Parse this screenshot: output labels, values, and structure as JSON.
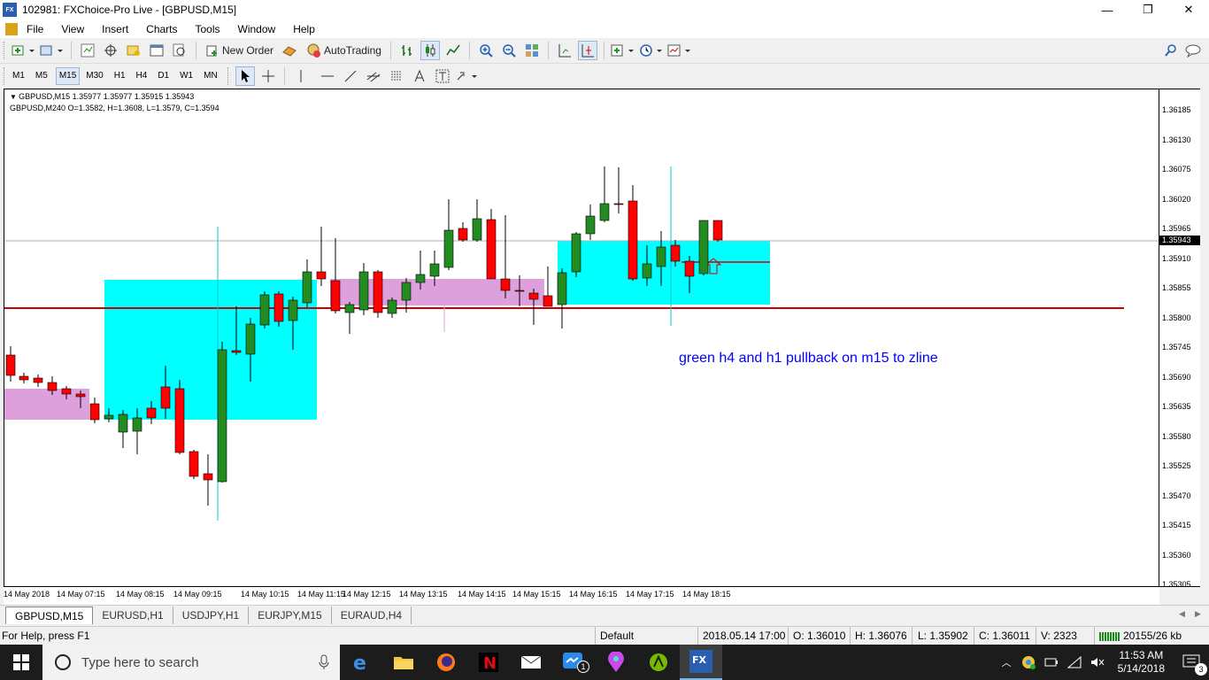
{
  "window": {
    "title": "102981: FXChoice-Pro Live - [GBPUSD,M15]",
    "logo_text": "FX",
    "minimize": "—",
    "maximize": "❐",
    "close": "✕"
  },
  "menu": [
    "File",
    "View",
    "Insert",
    "Charts",
    "Tools",
    "Window",
    "Help"
  ],
  "toolbar": {
    "new_order": "New Order",
    "autotrading": "AutoTrading"
  },
  "timeframes": [
    "M1",
    "M5",
    "M15",
    "M30",
    "H1",
    "H4",
    "D1",
    "W1",
    "MN"
  ],
  "active_timeframe": "M15",
  "chart": {
    "info_line_1": "GBPUSD,M15  1.35977 1.35977 1.35915 1.35943",
    "info_line_2": "GBPUSD,M240   O=1.3582,  H=1.3608,  L=1.3579,  C=1.3594",
    "annotation": "green h4 and h1 pullback on m15 to zline",
    "current_price_label": "1.35943",
    "price_ticks": [
      "1.36185",
      "1.36130",
      "1.36075",
      "1.36020",
      "1.35965",
      "1.35910",
      "1.35855",
      "1.35800",
      "1.35745",
      "1.35690",
      "1.35635",
      "1.35580",
      "1.35525",
      "1.35470",
      "1.35415",
      "1.35360",
      "1.35305"
    ],
    "time_ticks": [
      "14 May 2018",
      "14 May 07:15",
      "14 May 08:15",
      "14 May 09:15",
      "14 May 10:15",
      "14 May 11:15",
      "14 May 12:15",
      "14 May 13:15",
      "14 May 14:15",
      "14 May 15:15",
      "14 May 16:15",
      "14 May 17:15",
      "14 May 18:15"
    ],
    "colors": {
      "bull": "#228b22",
      "bear": "#ff0000",
      "h4_box": "#00ffff",
      "h1_box": "#dda0dd",
      "zline": "#cc0000"
    }
  },
  "tabs": [
    "GBPUSD,M15",
    "EURUSD,H1",
    "USDJPY,H1",
    "EURJPY,M15",
    "EURAUD,H4"
  ],
  "active_tab": "GBPUSD,M15",
  "status": {
    "help": "For Help, press F1",
    "profile": "Default",
    "datetime": "2018.05.14 17:00",
    "open": "O: 1.36010",
    "high": "H: 1.36076",
    "low": "L: 1.35902",
    "close": "C: 1.36011",
    "volume": "V: 2323",
    "traffic": "20155/26 kb"
  },
  "taskbar": {
    "search_placeholder": "Type here to search",
    "time": "11:53 AM",
    "date": "5/14/2018",
    "notification_count": "3",
    "messenger_badge": "1"
  }
}
